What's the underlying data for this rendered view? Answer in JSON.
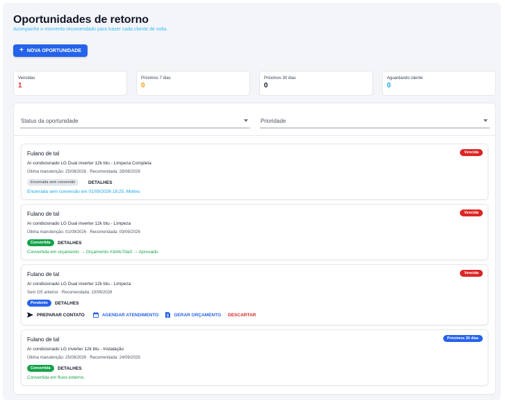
{
  "header": {
    "title": "Oportunidades de retorno",
    "subtitle": "Acompanhe o momento recomendado para trazer cada cliente de volta.",
    "new_button": "NOVA OPORTUNIDADE"
  },
  "stats": [
    {
      "label": "Vencidas",
      "value": "1",
      "color": "#dc2626"
    },
    {
      "label": "Próximos 7 dias",
      "value": "0",
      "color": "#f59e0b"
    },
    {
      "label": "Próximos 30 dias",
      "value": "0",
      "color": "#111827"
    },
    {
      "label": "Aguardando cliente",
      "value": "0",
      "color": "#0ea5e9"
    }
  ],
  "filters": {
    "status_placeholder": "Status da oportunidade",
    "priority_placeholder": "Prioridade"
  },
  "colors": {
    "accent": "#2563eb",
    "danger": "#dc2626",
    "success": "#16a34a",
    "info": "#0ea5e9"
  },
  "cards": [
    {
      "name": "Fulano de tal",
      "equipment": "Ar condicionado LG Dual inverter 12k btu - Limpeza Completa",
      "dates": "Última manutenção: 25/08/2026 · Recomendada: 28/08/2026",
      "badge": "Vencida",
      "chip": "Encerrada sem conversão",
      "details": "DETALHES",
      "note": "Encerrada sem conversão em 01/09/2026 18:25. Motivo:"
    },
    {
      "name": "Fulano de tal",
      "equipment": "Ar condicionado LG Dual inverter 12k btu - Limpeza",
      "dates": "Última manutenção: 01/09/2026 · Recomendada: 03/09/2026",
      "badge": "Vencida",
      "chip": "Convertida",
      "details": "DETALHES",
      "note": "Convertida em orçamento → Orçamento #3d4c7da3 → Aprovado"
    },
    {
      "name": "Fulano de tal",
      "equipment": "Ar condicionado LG Dual inverter 12k btu - Limpeza",
      "dates": "Sem OS anterior · Recomendada: 10/09/2026",
      "badge": "Vencida",
      "chip": "Pendente",
      "details": "DETALHES",
      "actions": {
        "send": "PREPARAR CONTATO",
        "schedule": "AGENDAR ATENDIMENTO",
        "quote": "GERAR ORÇAMENTO",
        "discard": "DESCARTAR"
      }
    },
    {
      "name": "Fulano de tal",
      "equipment": "Ar condicionado LG inverter 12k btu - Instalação",
      "dates": "Última manutenção: 25/08/2026 · Recomendada: 24/09/2026",
      "badge": "Próximos 30 dias",
      "chip": "Convertida",
      "details": "DETALHES",
      "note": "Convertida em fluxo externo."
    }
  ]
}
